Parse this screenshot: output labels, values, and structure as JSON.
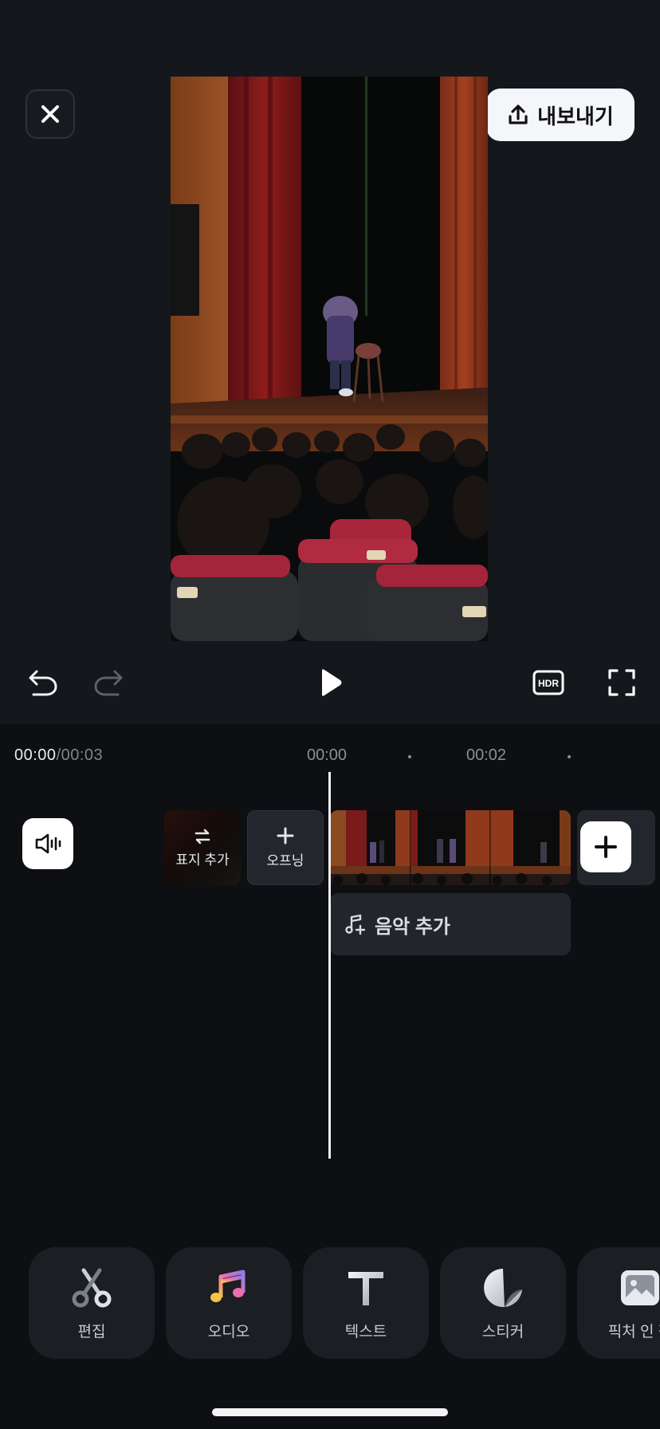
{
  "header": {
    "close_icon": "close-icon",
    "export_label": "내보내기",
    "export_icon": "upload-icon"
  },
  "preview": {
    "description_icon": "video-preview"
  },
  "controls": {
    "undo_icon": "undo-icon",
    "redo_icon": "redo-icon",
    "play_icon": "play-icon",
    "hdr_label": "HDR",
    "fullscreen_icon": "fullscreen-icon"
  },
  "timeline": {
    "current_time": "00:00",
    "total_time": "/00:03",
    "ruler": [
      "00:00",
      "00:02"
    ],
    "cover_label": "표지 추가",
    "opening_label": "오프닝",
    "music_label": "음악 추가"
  },
  "toolbar": {
    "items": [
      {
        "label": "편집",
        "icon": "scissors-icon"
      },
      {
        "label": "오디오",
        "icon": "music-note-icon"
      },
      {
        "label": "텍스트",
        "icon": "text-icon"
      },
      {
        "label": "스티커",
        "icon": "sticker-icon"
      },
      {
        "label": "픽처 인 픽",
        "icon": "picture-icon"
      }
    ]
  },
  "colors": {
    "background": "#14171c",
    "timeline_bg": "#0d0f12",
    "tile_bg": "#23262c",
    "export_bg": "#f4f6fa"
  }
}
